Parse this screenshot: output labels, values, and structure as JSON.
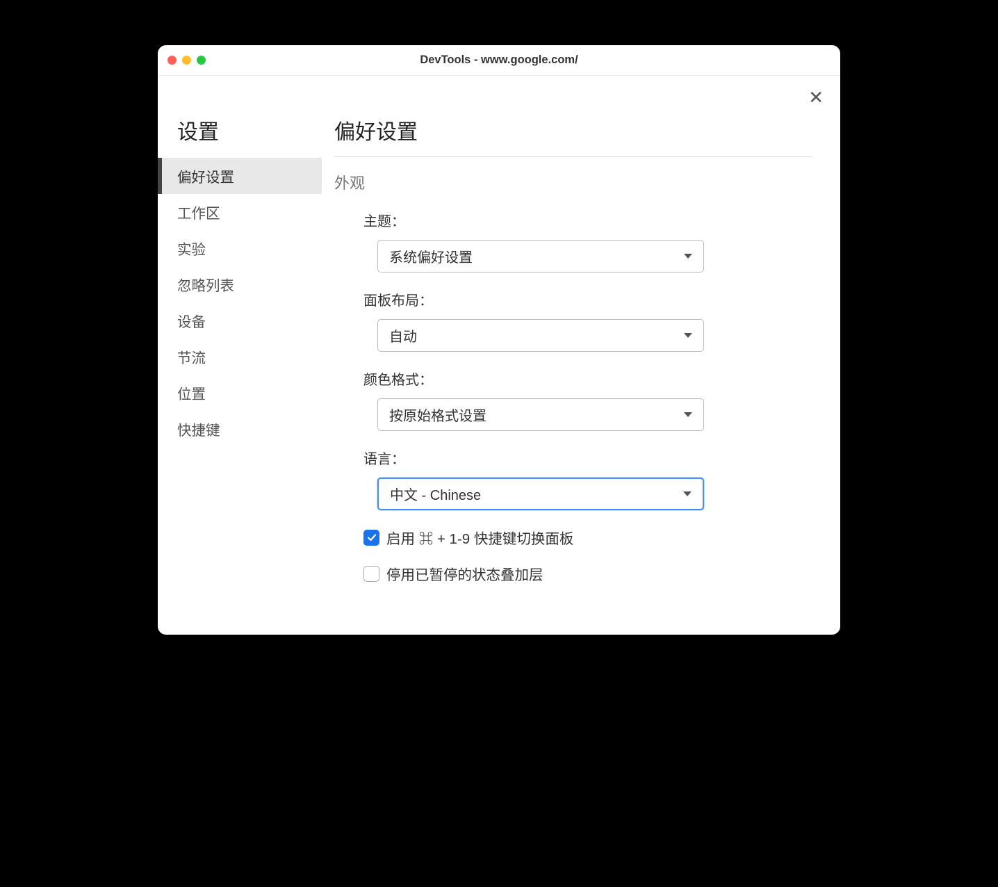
{
  "window": {
    "title": "DevTools - www.google.com/"
  },
  "sidebar": {
    "title": "设置",
    "items": [
      {
        "label": "偏好设置",
        "active": true
      },
      {
        "label": "工作区",
        "active": false
      },
      {
        "label": "实验",
        "active": false
      },
      {
        "label": "忽略列表",
        "active": false
      },
      {
        "label": "设备",
        "active": false
      },
      {
        "label": "节流",
        "active": false
      },
      {
        "label": "位置",
        "active": false
      },
      {
        "label": "快捷键",
        "active": false
      }
    ]
  },
  "main": {
    "title": "偏好设置",
    "section": {
      "label": "外观",
      "fields": {
        "theme": {
          "label": "主题：",
          "value": "系统偏好设置"
        },
        "panelLayout": {
          "label": "面板布局：",
          "value": "自动"
        },
        "colorFormat": {
          "label": "颜色格式：",
          "value": "按原始格式设置"
        },
        "language": {
          "label": "语言：",
          "value": "中文 - Chinese",
          "focused": true
        }
      },
      "checkboxes": {
        "shortcuts": {
          "label": "启用 ⌘ + 1-9 快捷键切换面板",
          "checked": true
        },
        "pausedOverlay": {
          "label": "停用已暂停的状态叠加层",
          "checked": false
        }
      }
    }
  }
}
